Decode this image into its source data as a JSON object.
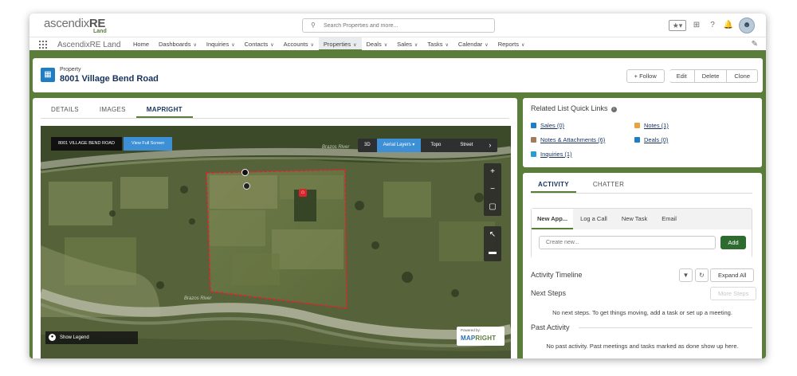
{
  "header": {
    "logo_main": "ascendix",
    "logo_bold": "RE",
    "logo_sub": "Land",
    "search_placeholder": "Search Properties and more..."
  },
  "nav": {
    "app_name": "AscendixRE Land",
    "items": [
      {
        "label": "Home",
        "chevron": false
      },
      {
        "label": "Dashboards",
        "chevron": true
      },
      {
        "label": "Inquiries",
        "chevron": true
      },
      {
        "label": "Contacts",
        "chevron": true
      },
      {
        "label": "Accounts",
        "chevron": true
      },
      {
        "label": "Properties",
        "chevron": true,
        "active": true
      },
      {
        "label": "Deals",
        "chevron": true
      },
      {
        "label": "Sales",
        "chevron": true
      },
      {
        "label": "Tasks",
        "chevron": true
      },
      {
        "label": "Calendar",
        "chevron": true
      },
      {
        "label": "Reports",
        "chevron": true
      }
    ]
  },
  "record": {
    "object_label": "Property",
    "title": "8001 Village Bend Road",
    "buttons": {
      "follow": "+ Follow",
      "edit": "Edit",
      "delete": "Delete",
      "clone": "Clone"
    }
  },
  "tabs": [
    {
      "label": "DETAILS",
      "active": false
    },
    {
      "label": "IMAGES",
      "active": false
    },
    {
      "label": "MAPRIGHT",
      "active": true
    }
  ],
  "map": {
    "property_label": "8001 VILLAGE BEND ROAD",
    "full_screen": "View Full Screen",
    "layers": {
      "three_d": "3D",
      "aerial": "Aerial Layers ▾",
      "topo": "Topo",
      "street": "Street"
    },
    "river_label": "Brazos River",
    "legend": "Show Legend",
    "powered_by": "Powered by:",
    "brand_a": "MAP",
    "brand_b": "RIGHT"
  },
  "quick_links": {
    "title": "Related List Quick Links",
    "links": [
      {
        "label": "Sales (0)",
        "color": "#1f7dc4"
      },
      {
        "label": "Notes (1)",
        "color": "#e8a33d"
      },
      {
        "label": "Notes & Attachments (6)",
        "color": "#a07c5a"
      },
      {
        "label": "Deals (0)",
        "color": "#1f7dc4"
      },
      {
        "label": "Inquiries (1)",
        "color": "#2a9bd6"
      }
    ]
  },
  "activity": {
    "tabs": [
      {
        "label": "ACTIVITY",
        "active": true
      },
      {
        "label": "CHATTER",
        "active": false
      }
    ],
    "composer_tabs": [
      {
        "label": "New App...",
        "active": true
      },
      {
        "label": "Log a Call",
        "active": false
      },
      {
        "label": "New Task",
        "active": false
      },
      {
        "label": "Email",
        "active": false
      }
    ],
    "input_placeholder": "Create new...",
    "add_label": "Add",
    "timeline_title": "Activity Timeline",
    "expand_all": "Expand All",
    "next_steps": "Next Steps",
    "more_steps": "More Steps",
    "next_steps_msg": "No next steps. To get things moving, add a task or set up a meeting.",
    "past_activity": "Past Activity",
    "past_msg": "No past activity. Past meetings and tasks marked as done show up here."
  },
  "colors": {
    "accent": "#5a7d3a",
    "brand_blue": "#1f7dc4",
    "boundary": "#d9262c"
  }
}
